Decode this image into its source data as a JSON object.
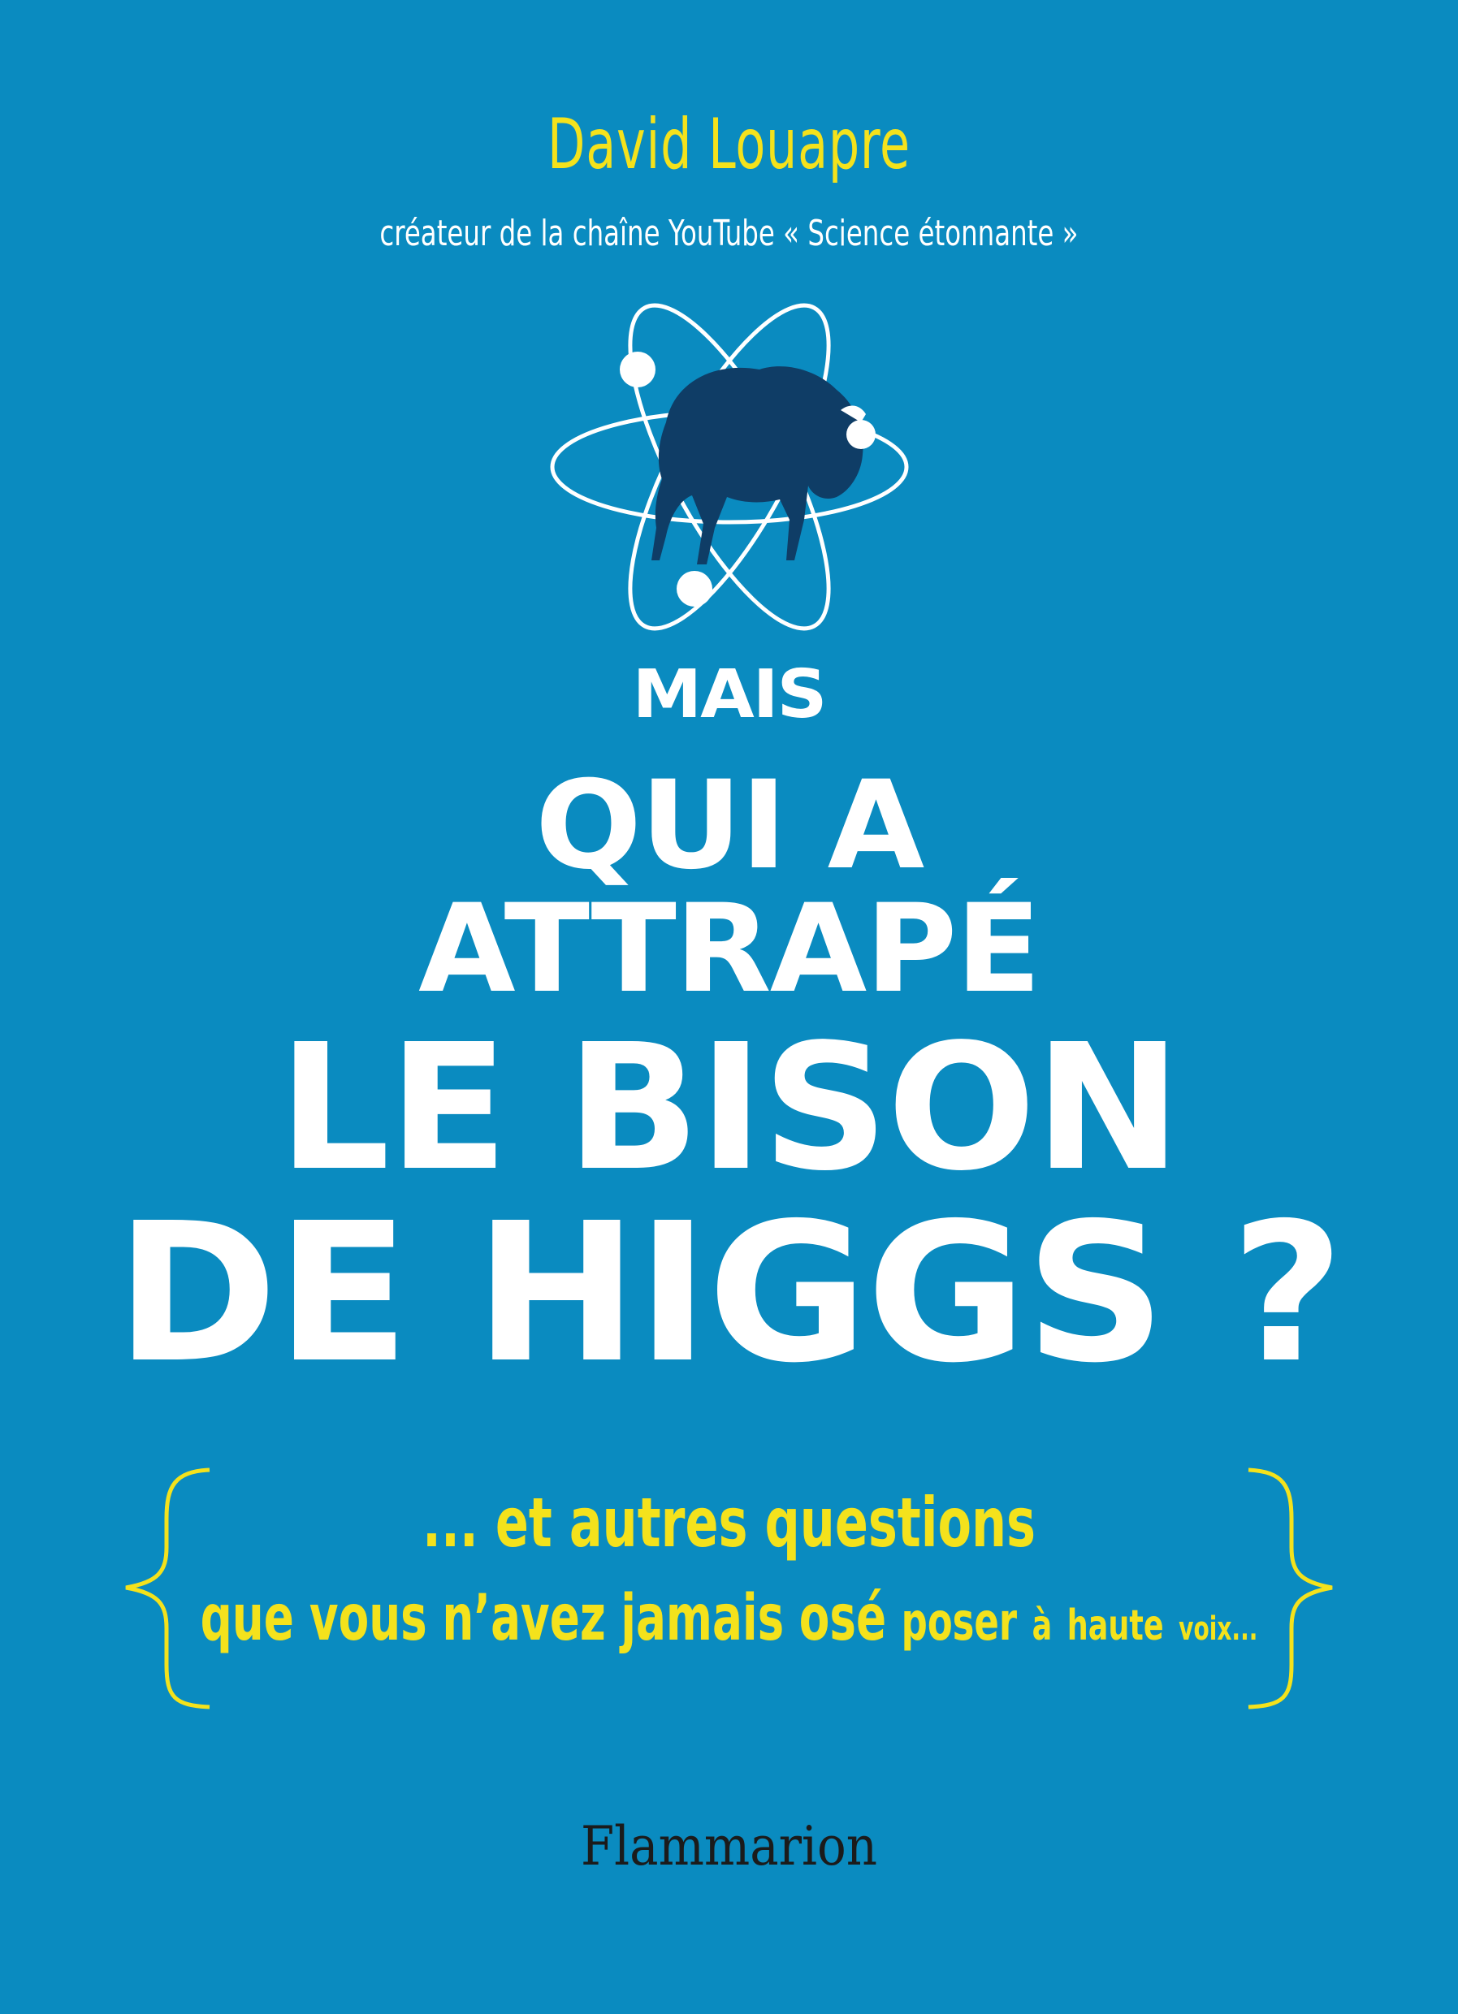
{
  "cover": {
    "background_color": "#0a8bc0",
    "accent_color": "#f4e21c",
    "author": "David Louapre",
    "author_subtitle": "créateur de la chaîne YouTube « Science étonnante »",
    "title": {
      "line1": "MAIS",
      "line2": "QUI A",
      "line3": "ATTRAPÉ",
      "line4": "LE BISON",
      "line5": "DE HIGGS ?"
    },
    "tagline": {
      "line1": "... et autres questions",
      "line2_part1": "que vous",
      "line2_part2": "n’avez",
      "line2_part3": "jamais",
      "line2_part4": "osé",
      "line2_part5": "poser",
      "line2_part6": "à",
      "line2_part7": "haute",
      "line2_part8": "voix..."
    },
    "illustration_icons": [
      "atom-icon",
      "bison-icon"
    ],
    "publisher": "Flammarion"
  }
}
